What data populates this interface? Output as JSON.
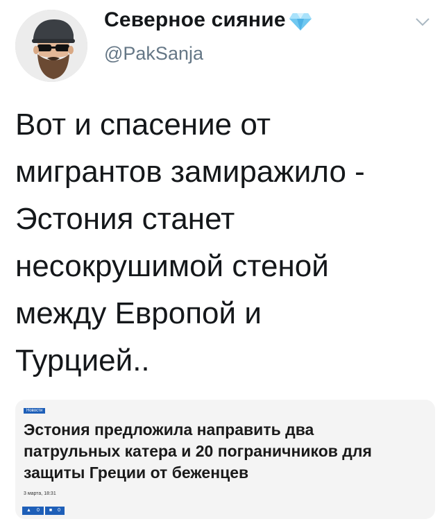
{
  "user": {
    "display_name": "Северное сияние",
    "handle": "@PakSanja",
    "verified_icon": "diamond-icon",
    "menu_icon": "chevron-down-icon"
  },
  "tweet": {
    "text": "Вот и спасение от\nмигрантов замиражило -\nЭстония станет\nнесокрушимой стеной\nмежду Европой и\nТурцией.."
  },
  "card": {
    "tag": "Новости",
    "title": "Эстония предложила направить два\nпатрульных катера и 20 пограничников для\nзащиты Греции от беженцев",
    "date": "3 марта, 18:31",
    "actions": [
      {
        "icon": "thumbs-up-icon",
        "count": "0"
      },
      {
        "icon": "comment-icon",
        "count": "0"
      }
    ]
  },
  "colors": {
    "handle": "#657786",
    "card_accent": "#1e5fb8",
    "card_bg": "#f4f4f4"
  }
}
